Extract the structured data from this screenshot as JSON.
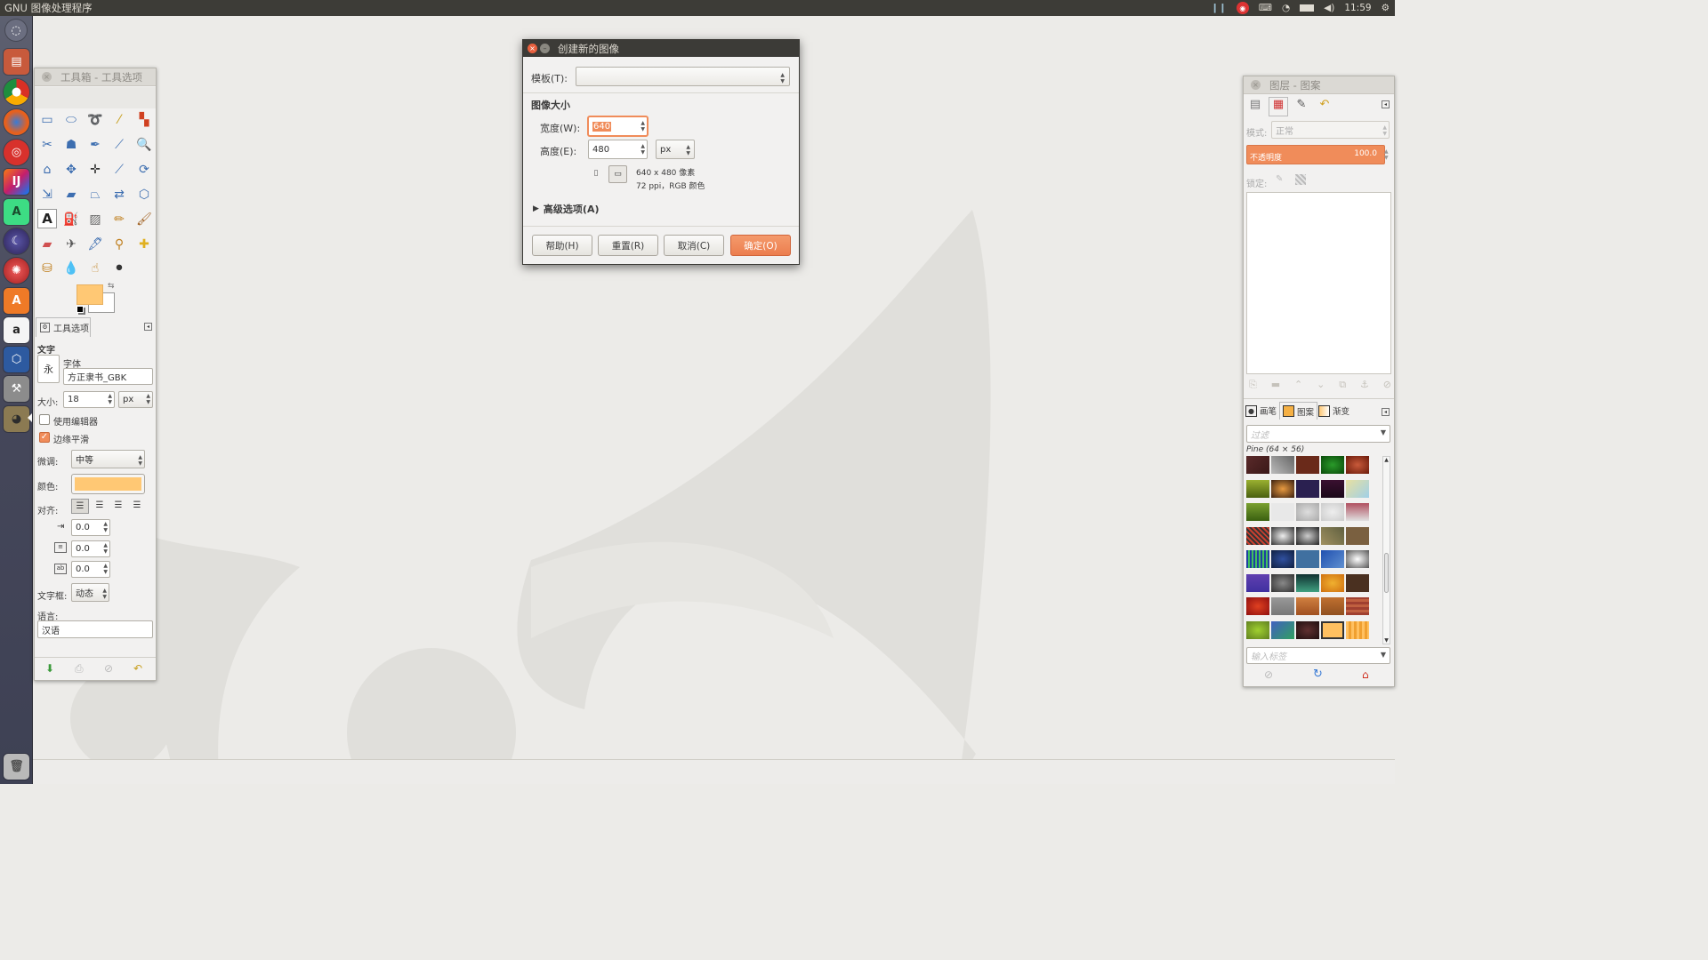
{
  "topbar": {
    "app_title": "GNU 图像处理程序",
    "clock": "11:59"
  },
  "launcher": {
    "items": [
      "dash",
      "files",
      "chrome",
      "firefox",
      "netease-music",
      "intellij",
      "android-studio",
      "eclipse",
      "aptana",
      "software-center",
      "amazon",
      "virtualbox",
      "system-settings",
      "gimp"
    ],
    "trash": "trash"
  },
  "toolbox": {
    "title": "工具箱 - 工具选项",
    "tab_label": "工具选项",
    "section": "文字",
    "font_label": "字体",
    "font_value": "方正隶书_GBK",
    "font_preview": "永",
    "size_label": "大小:",
    "size_value": "18",
    "size_unit": "px",
    "use_editor_label": "使用编辑器",
    "use_editor_checked": false,
    "antialias_label": "边缘平滑",
    "antialias_checked": true,
    "hinting_label": "微调:",
    "hinting_value": "中等",
    "color_label": "颜色:",
    "text_color": "#ffc874",
    "justify_label": "对齐:",
    "indent_value": "0.0",
    "line_spacing_value": "0.0",
    "letter_spacing_value": "0.0",
    "box_label": "文字框:",
    "box_value": "动态",
    "language_label": "语言:",
    "language_value": "汉语",
    "fg_color": "#ffc874",
    "bg_color": "#ffffff"
  },
  "dialog": {
    "title": "创建新的图像",
    "template_label": "模板(T):",
    "template_value": "",
    "image_size_heading": "图像大小",
    "width_label": "宽度(W):",
    "width_value": "640",
    "height_label": "高度(E):",
    "height_value": "480",
    "unit_value": "px",
    "size_info": "640 x 480 像素",
    "resolution_info": "72 ppi，RGB 颜色",
    "advanced_label": "高级选项(A)",
    "help_button": "帮助(H)",
    "reset_button": "重置(R)",
    "cancel_button": "取消(C)",
    "ok_button": "确定(O)",
    "accent_color": "#f08c5a"
  },
  "layers_panel": {
    "title": "图层 - 图案",
    "mode_label": "模式:",
    "mode_value": "正常",
    "opacity_label": "不透明度",
    "opacity_value": "100.0",
    "lock_label": "锁定:",
    "tab_brushes": "画笔",
    "tab_patterns": "图案",
    "tab_gradients": "渐变",
    "filter_placeholder": "过滤",
    "pattern_name": "Pine (64 × 56)",
    "tag_placeholder": "输入标签"
  }
}
